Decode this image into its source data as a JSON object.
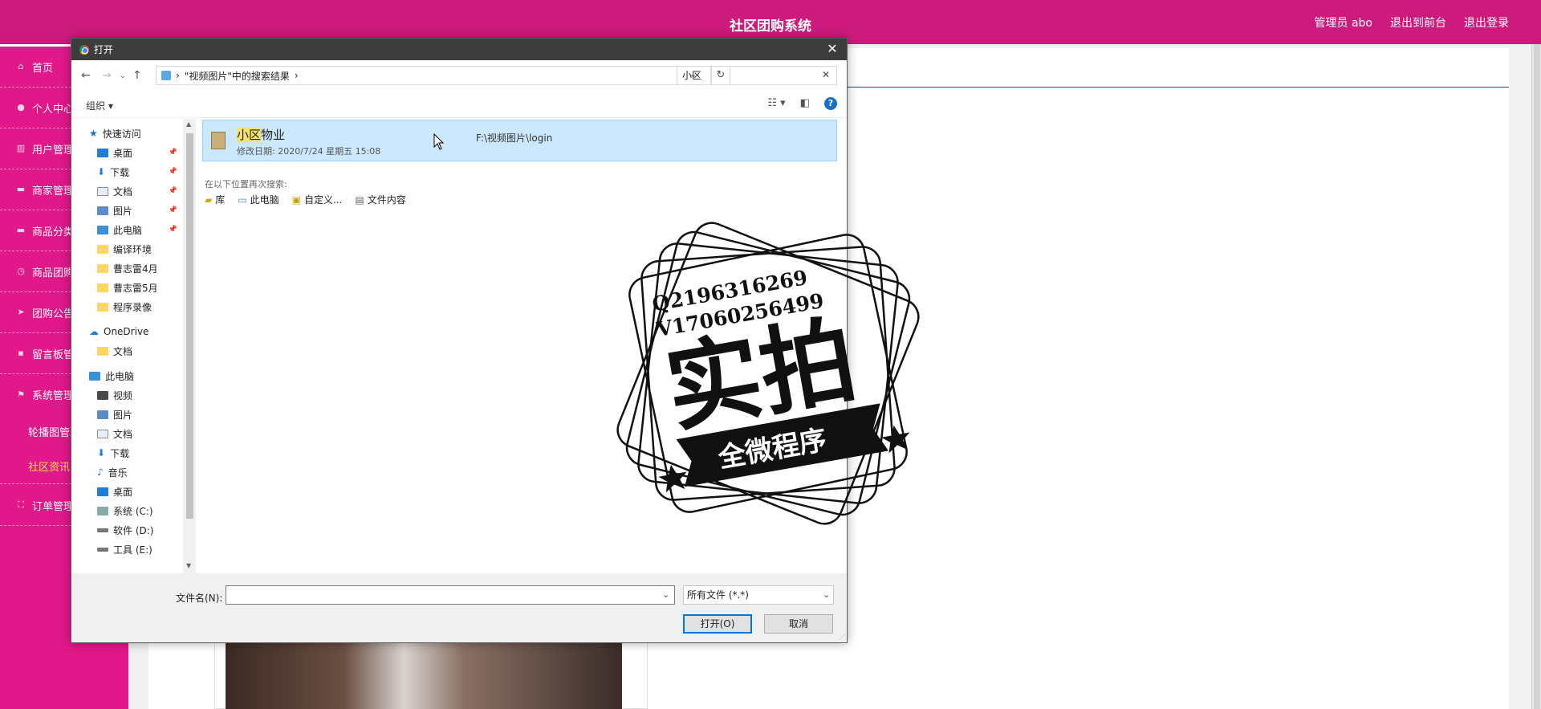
{
  "header": {
    "title": "社区团购系统",
    "links": [
      "管理员 abo",
      "退出到前台",
      "退出登录"
    ]
  },
  "sidebar": {
    "items": [
      {
        "label": "首页",
        "icon": "home-icon"
      },
      {
        "label": "个人中心",
        "icon": "user-icon"
      },
      {
        "label": "用户管理",
        "icon": "chart-icon"
      },
      {
        "label": "商家管理",
        "icon": "briefcase-icon"
      },
      {
        "label": "商品分类",
        "icon": "briefcase-icon"
      },
      {
        "label": "商品团购",
        "icon": "clock-icon"
      },
      {
        "label": "团购公告",
        "icon": "send-icon"
      },
      {
        "label": "留言板管理",
        "icon": "chat-icon"
      },
      {
        "label": "系统管理",
        "icon": "flag-icon"
      }
    ],
    "subs": [
      {
        "label": "轮播图管理"
      },
      {
        "label": "社区资讯"
      }
    ],
    "last": {
      "label": "订单管理",
      "icon": "fullscreen-icon"
    }
  },
  "dialog": {
    "title": "打开",
    "path": "\"视频图片\"中的搜索结果",
    "search": "小区",
    "organize": "组织",
    "nav": {
      "quick": "快速访问",
      "quick_items": [
        "桌面",
        "下载",
        "文档",
        "图片",
        "此电脑",
        "编译环境",
        "曹志雷4月",
        "曹志雷5月",
        "程序录像"
      ],
      "onedrive": "OneDrive",
      "onedrive_items": [
        "文档"
      ],
      "pc": "此电脑",
      "pc_items": [
        "视频",
        "图片",
        "文档",
        "下载",
        "音乐",
        "桌面",
        "系统 (C:)",
        "软件 (D:)",
        "工具 (E:)"
      ]
    },
    "result": {
      "highlight": "小区",
      "name_rest": "物业",
      "date": "修改日期: 2020/7/24 星期五 15:08",
      "path": "F:\\视频图片\\login"
    },
    "again_label": "在以下位置再次搜索:",
    "again_items": [
      "库",
      "此电脑",
      "自定义...",
      "文件内容"
    ],
    "filename_label": "文件名(N):",
    "filename_value": "",
    "filetype": "所有文件 (*.*)",
    "open_btn": "打开(O)",
    "cancel_btn": "取消"
  },
  "stamp": {
    "qq": "Q2196316269",
    "wx": "V17060256499",
    "big": "实拍",
    "banner": "全微程序"
  },
  "colors": {
    "topbar": "#cc1b7d",
    "sidebar": "#e0188a",
    "selection": "#cce8ff",
    "accent": "#0078d7"
  }
}
